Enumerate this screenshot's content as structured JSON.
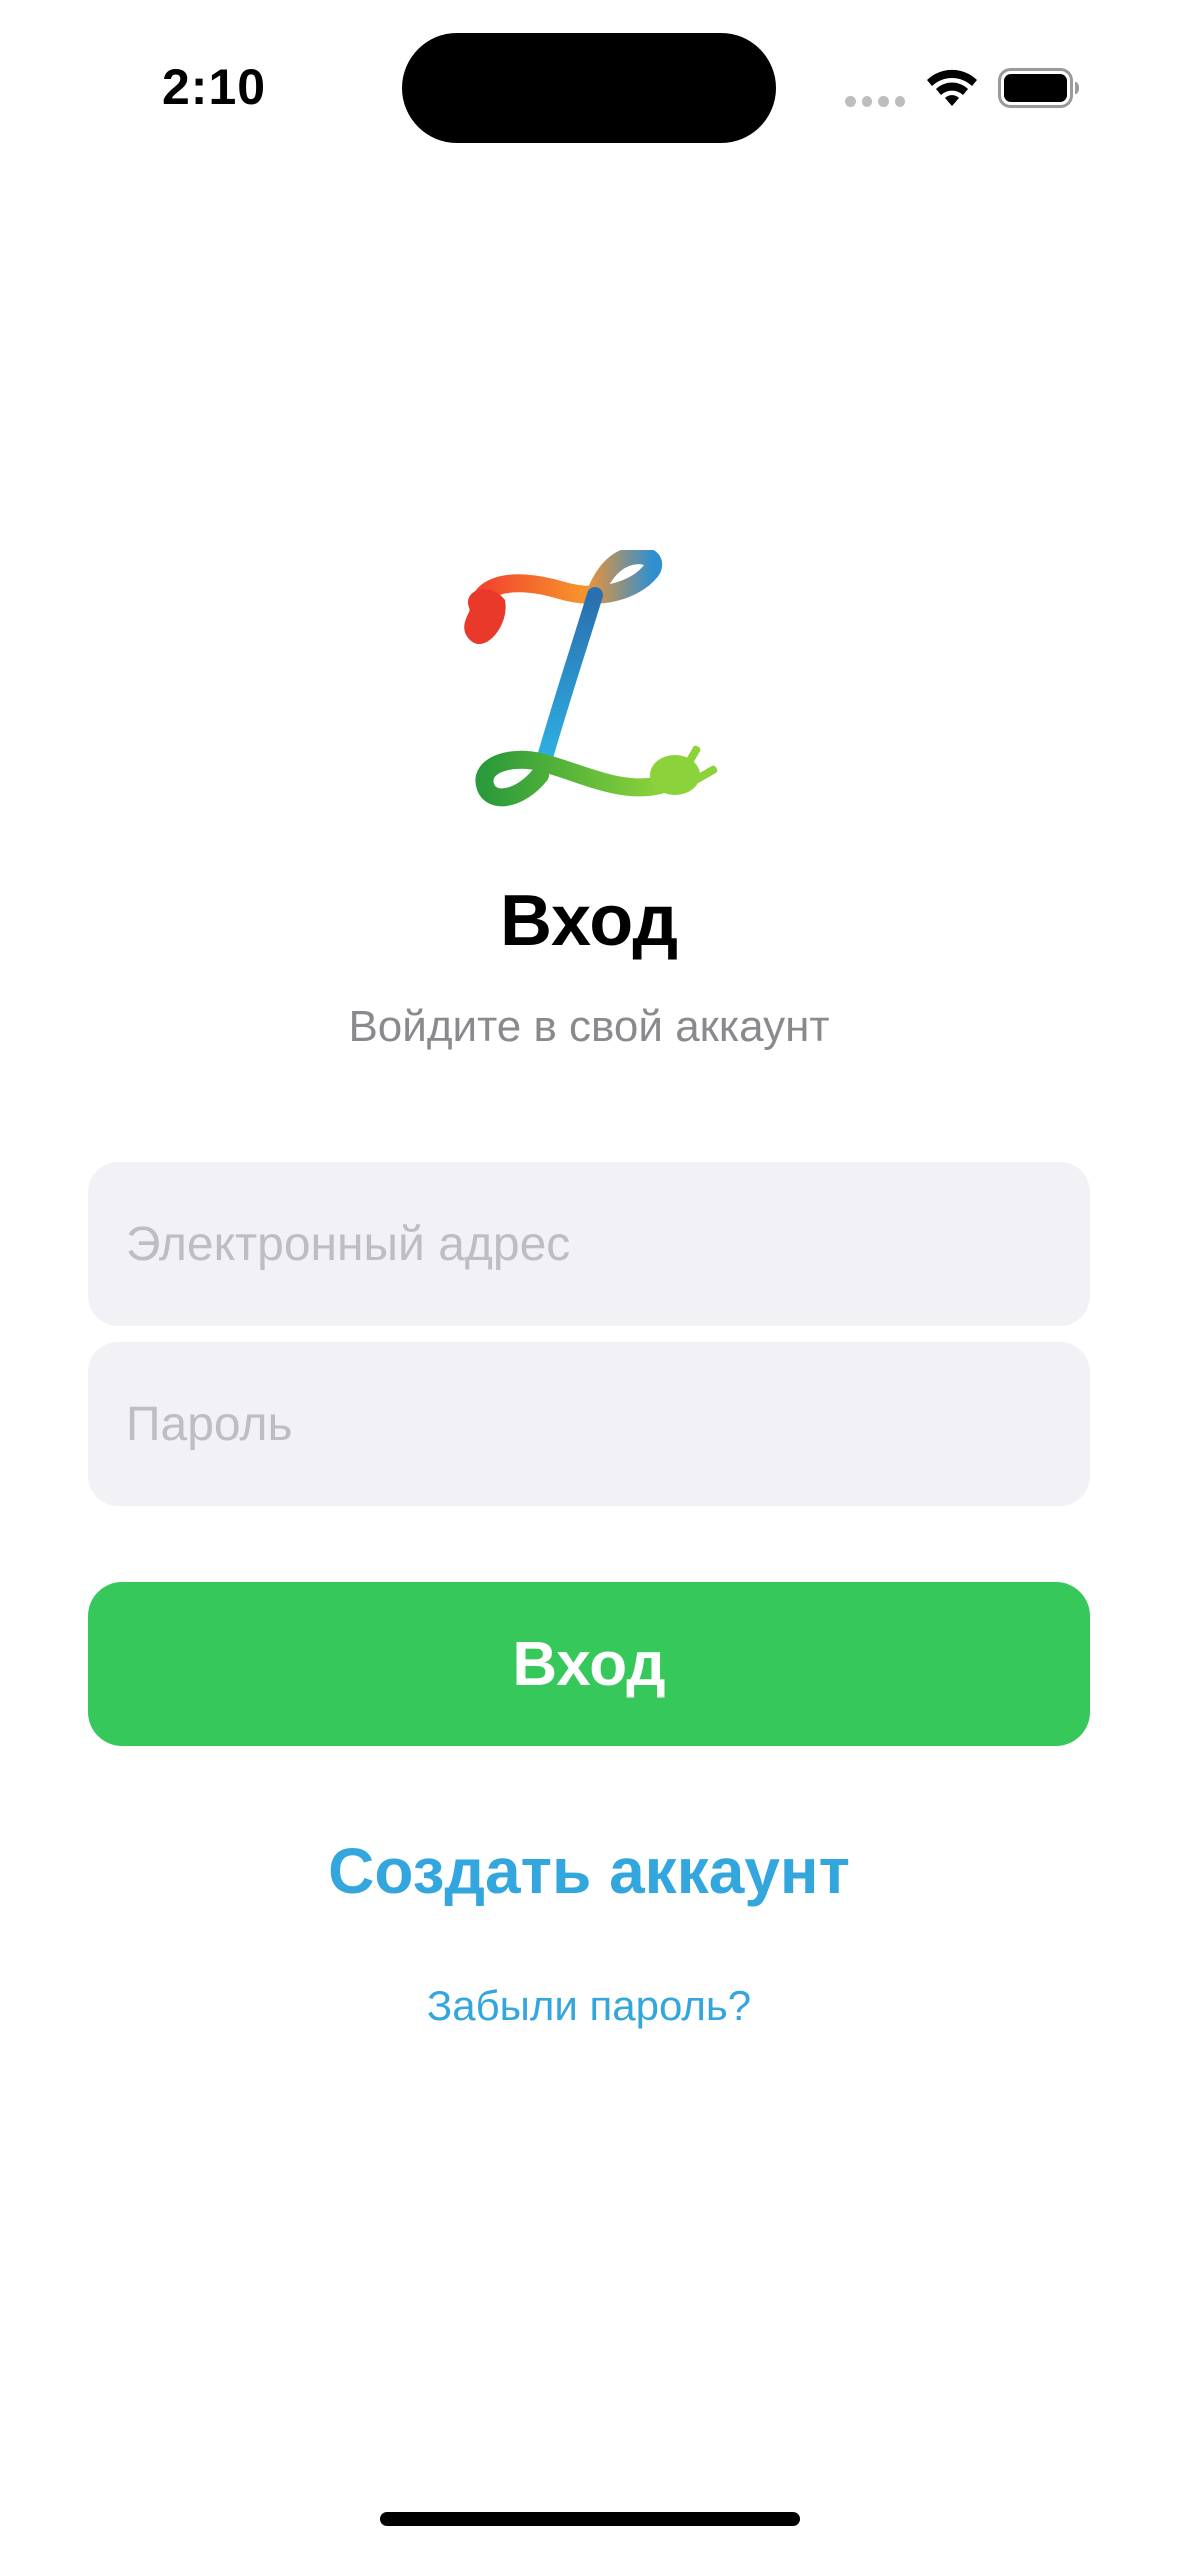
{
  "status_bar": {
    "time": "2:10",
    "icons": [
      "cellular-signal-icon",
      "wifi-icon",
      "battery-icon"
    ]
  },
  "logo": {
    "icon": "app-logo-plug-icon"
  },
  "header": {
    "title": "Вход",
    "subtitle": "Войдите в свой аккаунт"
  },
  "form": {
    "email_placeholder": "Электронный адрес",
    "email_value": "",
    "password_placeholder": "Пароль",
    "password_value": "",
    "submit_label": "Вход"
  },
  "links": {
    "create_account": "Создать аккаунт",
    "forgot_password": "Забыли пароль?"
  },
  "colors": {
    "primary_button": "#36c85a",
    "link": "#33a6de",
    "field_background": "#f2f2f6",
    "subtitle": "#8a8a8e"
  }
}
